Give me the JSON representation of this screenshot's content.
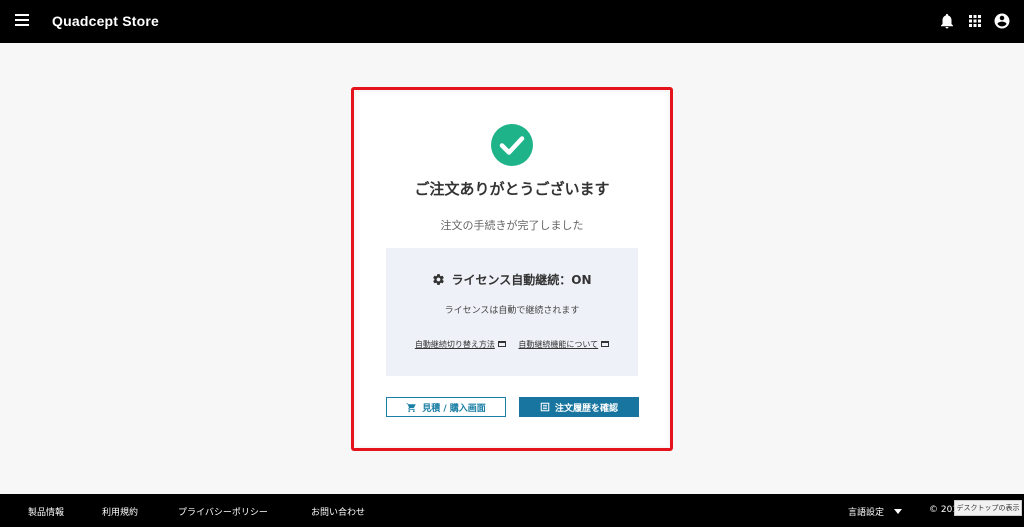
{
  "header": {
    "app_title": "Quadcept Store",
    "icons": [
      "menu-icon",
      "bell-icon",
      "apps-grid-icon",
      "account-icon"
    ]
  },
  "order_complete": {
    "title": "ご注文ありがとうございます",
    "subtitle": "注文の手続きが完了しました",
    "license": {
      "heading": "ライセンス自動継続：ON",
      "description": "ライセンスは自動で継続されます",
      "link_switch": "自動継続切り替え方法",
      "link_about": "自動継続機能について"
    },
    "buttons": {
      "quote_purchase": "見積 / 購入画面",
      "order_history": "注文履歴を確認"
    }
  },
  "footer": {
    "links": [
      "製品情報",
      "利用規約",
      "プライバシーポリシー",
      "お問い合わせ"
    ],
    "language_label": "言語設定",
    "copyright": "© 2017",
    "desktop_view": "デスクトップの表示"
  },
  "colors": {
    "header_bg": "#000000",
    "highlight": "#e5131b",
    "success": "#1fb389",
    "primary": "#18759f",
    "panel_bg": "#eef1f7"
  }
}
